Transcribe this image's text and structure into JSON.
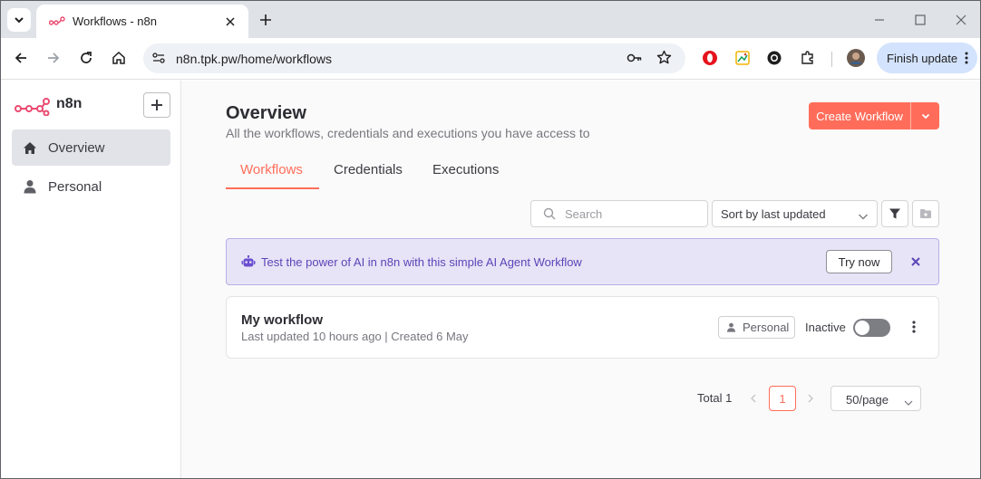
{
  "browser": {
    "tab_title": "Workflows - n8n",
    "url": "n8n.tpk.pw/home/workflows",
    "finish_update_label": "Finish update"
  },
  "sidebar": {
    "logo_text": "n8n",
    "items": [
      {
        "label": "Overview",
        "icon": "home-icon",
        "active": true
      },
      {
        "label": "Personal",
        "icon": "user-icon",
        "active": false
      }
    ]
  },
  "header": {
    "title": "Overview",
    "subtitle": "All the workflows, credentials and executions you have access to",
    "create_label": "Create Workflow"
  },
  "tabs": [
    {
      "label": "Workflows",
      "active": true
    },
    {
      "label": "Credentials",
      "active": false
    },
    {
      "label": "Executions",
      "active": false
    }
  ],
  "filters": {
    "search_placeholder": "Search",
    "sort_label": "Sort by last updated"
  },
  "banner": {
    "text": "Test the power of AI in n8n with this simple AI Agent Workflow",
    "try_label": "Try now"
  },
  "workflows": [
    {
      "name": "My workflow",
      "meta": "Last updated 10 hours ago | Created 6 May",
      "owner": "Personal",
      "status": "Inactive",
      "active": false
    }
  ],
  "pagination": {
    "total_label": "Total 1",
    "current_page": "1",
    "page_size": "50/page"
  },
  "colors": {
    "accent": "#ff6d5a",
    "banner_bg": "#e8e4f7",
    "banner_text": "#5b45b8"
  }
}
